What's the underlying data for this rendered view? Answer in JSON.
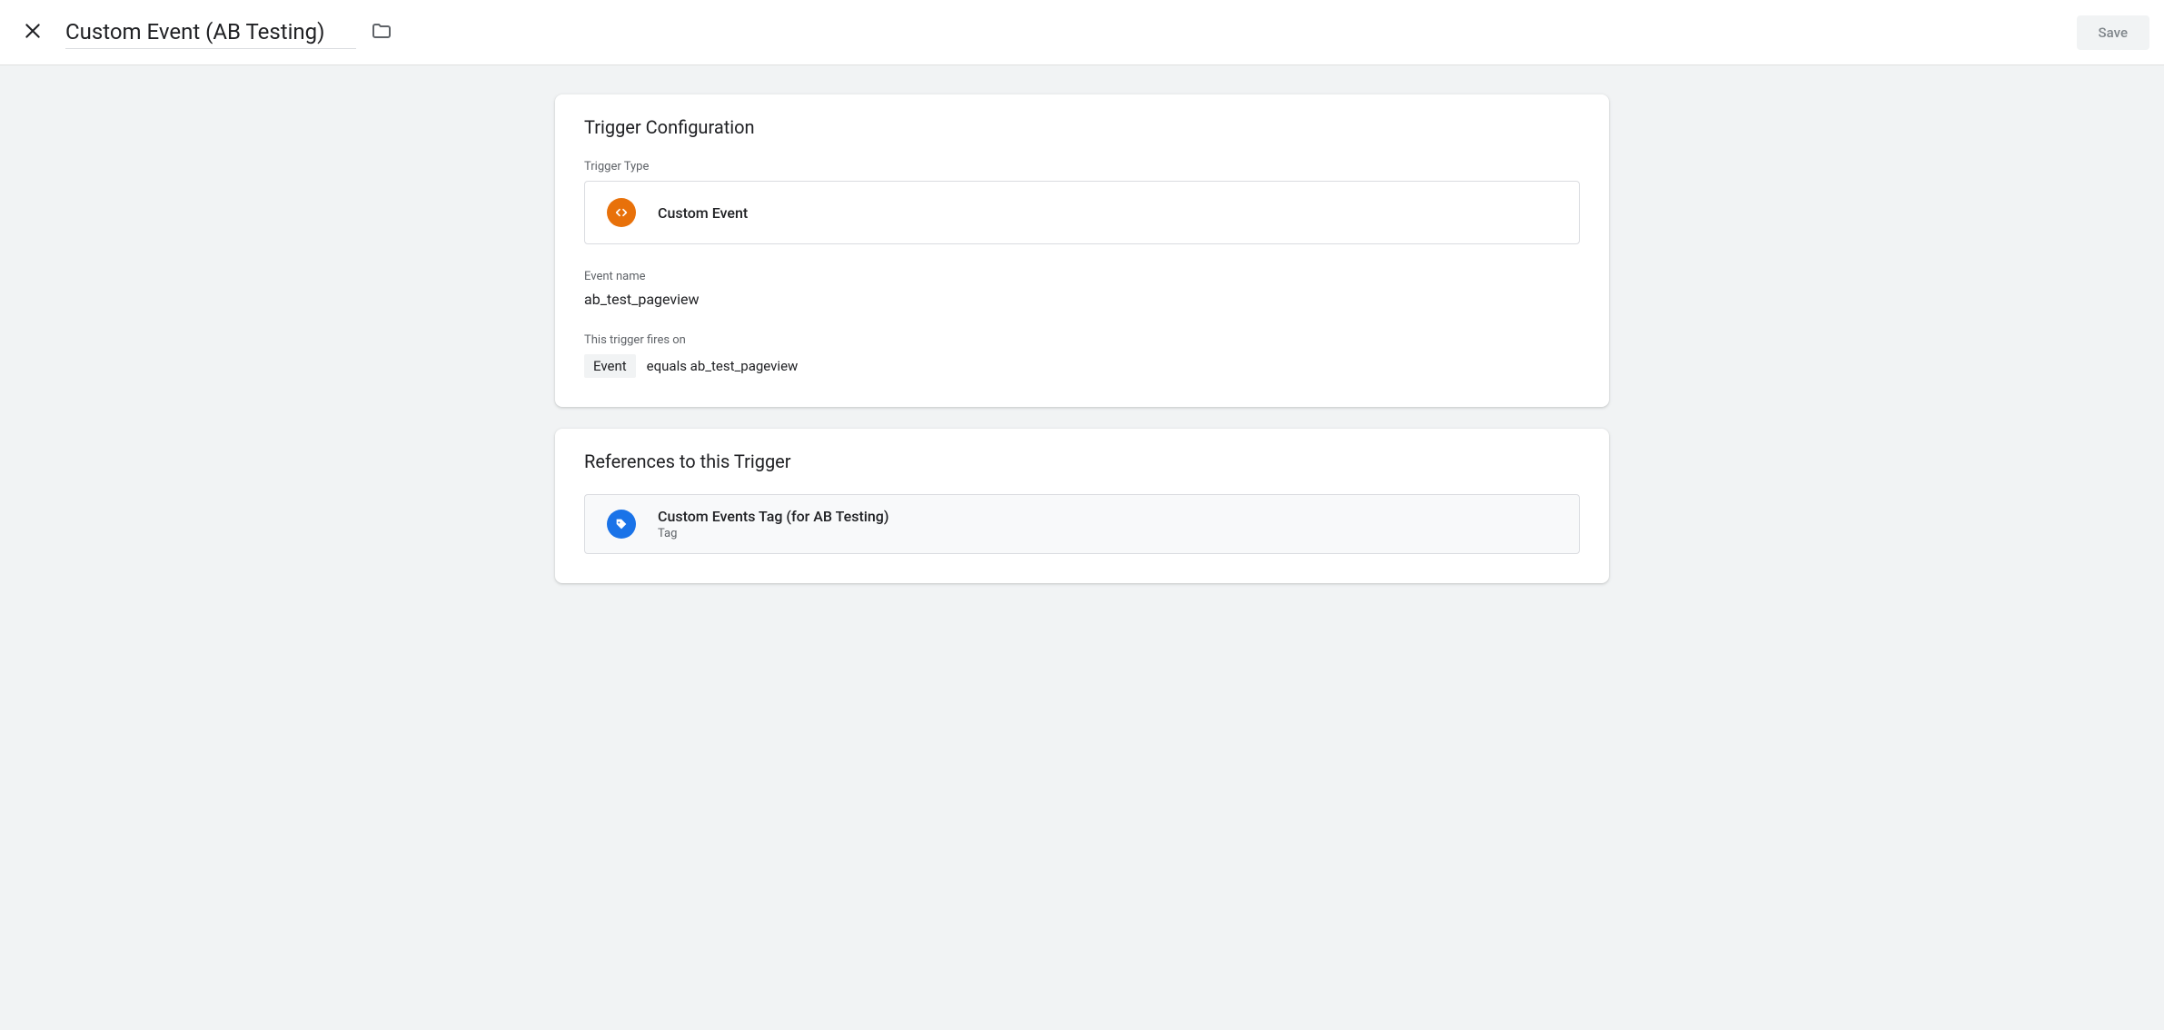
{
  "header": {
    "title": "Custom Event (AB Testing)",
    "save_label": "Save"
  },
  "trigger_config": {
    "heading": "Trigger Configuration",
    "trigger_type_label": "Trigger Type",
    "trigger_type_value": "Custom Event",
    "event_name_label": "Event name",
    "event_name_value": "ab_test_pageview",
    "fires_on_label": "This trigger fires on",
    "fires_on_variable": "Event",
    "fires_on_condition": "equals ab_test_pageview"
  },
  "references": {
    "heading": "References to this Trigger",
    "items": [
      {
        "name": "Custom Events Tag (for AB Testing)",
        "type": "Tag"
      }
    ]
  }
}
